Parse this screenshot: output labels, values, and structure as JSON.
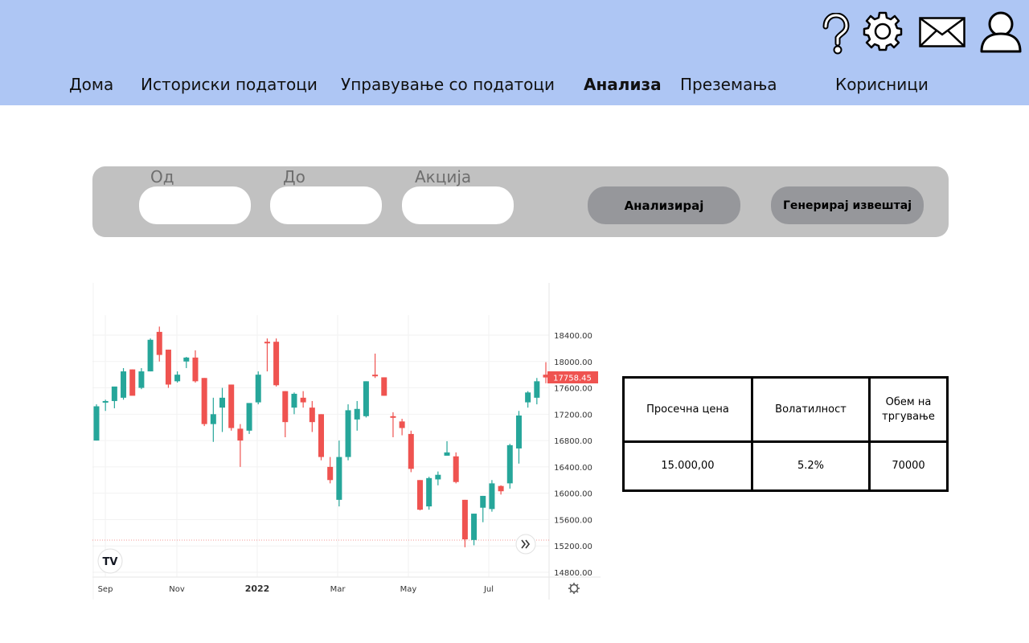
{
  "header": {
    "icons": [
      "help-icon",
      "gear-icon",
      "mail-icon",
      "user-icon"
    ],
    "background": "#aec6f4"
  },
  "nav": {
    "items": [
      {
        "label": "Дома"
      },
      {
        "label": "Историски податоци"
      },
      {
        "label": "Управување со податоци"
      },
      {
        "label": "Анализа",
        "active": true
      },
      {
        "label": "Преземања"
      },
      {
        "label": "Корисници"
      }
    ]
  },
  "filters": {
    "from_label": "Од",
    "from_value": "",
    "to_label": "До",
    "to_value": "",
    "stock_label": "Акција",
    "stock_value": "",
    "analyze_button": "Анализирај",
    "report_button": "Генерирај извештај",
    "panel_color": "#c1c1c1",
    "button_color": "#96979b"
  },
  "chart_data": {
    "type": "candlestick",
    "title": "",
    "x_ticks": [
      "Sep",
      "Nov",
      "2022",
      "Mar",
      "May",
      "Jul"
    ],
    "y_ticks": [
      18400,
      18000,
      17600,
      17200,
      16800,
      16400,
      16000,
      15600,
      15200,
      14800
    ],
    "y_tick_labels": [
      "18400.00",
      "18000.00",
      "17600.00",
      "17200.00",
      "16800.00",
      "16400.00",
      "16000.00",
      "15600.00",
      "15200.00",
      "14800.00"
    ],
    "ylim": [
      14800,
      18600
    ],
    "last_price": 17758.45,
    "last_price_label": "17758.45",
    "up_color": "#26a69a",
    "down_color": "#ef5350",
    "grid": true,
    "candles": [
      {
        "o": 16800,
        "h": 17350,
        "l": 16800,
        "c": 17320
      },
      {
        "o": 17380,
        "h": 17420,
        "l": 17250,
        "c": 17400
      },
      {
        "o": 17400,
        "h": 17560,
        "l": 17290,
        "c": 17620
      },
      {
        "o": 17450,
        "h": 17900,
        "l": 17420,
        "c": 17850
      },
      {
        "o": 17880,
        "h": 17880,
        "l": 17500,
        "c": 17480
      },
      {
        "o": 17600,
        "h": 17900,
        "l": 17580,
        "c": 17850
      },
      {
        "o": 17850,
        "h": 18350,
        "l": 17850,
        "c": 18330
      },
      {
        "o": 18450,
        "h": 18530,
        "l": 18000,
        "c": 18100
      },
      {
        "o": 18180,
        "h": 18180,
        "l": 17600,
        "c": 17650
      },
      {
        "o": 17700,
        "h": 17850,
        "l": 17680,
        "c": 17800
      },
      {
        "o": 18000,
        "h": 18070,
        "l": 17900,
        "c": 18060
      },
      {
        "o": 18060,
        "h": 18170,
        "l": 17680,
        "c": 17700
      },
      {
        "o": 17750,
        "h": 17750,
        "l": 17020,
        "c": 17050
      },
      {
        "o": 17050,
        "h": 17450,
        "l": 16780,
        "c": 17200
      },
      {
        "o": 17300,
        "h": 17600,
        "l": 16930,
        "c": 17450
      },
      {
        "o": 17650,
        "h": 17650,
        "l": 16950,
        "c": 16990
      },
      {
        "o": 16980,
        "h": 17050,
        "l": 16400,
        "c": 16800
      },
      {
        "o": 16950,
        "h": 17350,
        "l": 16900,
        "c": 17370
      },
      {
        "o": 17380,
        "h": 17850,
        "l": 17350,
        "c": 17800
      },
      {
        "o": 18300,
        "h": 18350,
        "l": 17850,
        "c": 18280
      },
      {
        "o": 18300,
        "h": 18350,
        "l": 17620,
        "c": 17640
      },
      {
        "o": 17550,
        "h": 17550,
        "l": 16850,
        "c": 17080
      },
      {
        "o": 17300,
        "h": 17530,
        "l": 17200,
        "c": 17510
      },
      {
        "o": 17450,
        "h": 17550,
        "l": 17300,
        "c": 17380
      },
      {
        "o": 17300,
        "h": 17400,
        "l": 16930,
        "c": 17080
      },
      {
        "o": 17200,
        "h": 17200,
        "l": 16500,
        "c": 16550
      },
      {
        "o": 16400,
        "h": 16550,
        "l": 16150,
        "c": 16200
      },
      {
        "o": 15900,
        "h": 16800,
        "l": 15800,
        "c": 16550
      },
      {
        "o": 16550,
        "h": 17350,
        "l": 16500,
        "c": 17260
      },
      {
        "o": 17120,
        "h": 17400,
        "l": 16950,
        "c": 17280
      },
      {
        "o": 17170,
        "h": 17700,
        "l": 17150,
        "c": 17700
      },
      {
        "o": 17800,
        "h": 18120,
        "l": 17750,
        "c": 17790
      },
      {
        "o": 17760,
        "h": 17760,
        "l": 17480,
        "c": 17480
      },
      {
        "o": 17170,
        "h": 17230,
        "l": 16850,
        "c": 17160
      },
      {
        "o": 17090,
        "h": 17130,
        "l": 16880,
        "c": 16990
      },
      {
        "o": 16900,
        "h": 16950,
        "l": 16320,
        "c": 16370
      },
      {
        "o": 16200,
        "h": 16200,
        "l": 15740,
        "c": 15750
      },
      {
        "o": 15800,
        "h": 16250,
        "l": 15750,
        "c": 16230
      },
      {
        "o": 16210,
        "h": 16330,
        "l": 16120,
        "c": 16280
      },
      {
        "o": 16570,
        "h": 16790,
        "l": 16570,
        "c": 16620
      },
      {
        "o": 16560,
        "h": 16620,
        "l": 16150,
        "c": 16170
      },
      {
        "o": 15900,
        "h": 15900,
        "l": 15180,
        "c": 15300
      },
      {
        "o": 15290,
        "h": 15690,
        "l": 15210,
        "c": 15690
      },
      {
        "o": 15780,
        "h": 15960,
        "l": 15560,
        "c": 15960
      },
      {
        "o": 15760,
        "h": 16200,
        "l": 15720,
        "c": 16150
      },
      {
        "o": 16110,
        "h": 16120,
        "l": 15980,
        "c": 16030
      },
      {
        "o": 16150,
        "h": 16750,
        "l": 16070,
        "c": 16730
      },
      {
        "o": 16680,
        "h": 17250,
        "l": 16450,
        "c": 17180
      },
      {
        "o": 17380,
        "h": 17550,
        "l": 17300,
        "c": 17530
      },
      {
        "o": 17450,
        "h": 17750,
        "l": 17350,
        "c": 17700
      },
      {
        "o": 17800,
        "h": 17990,
        "l": 17670,
        "c": 17758
      }
    ]
  },
  "stats_table": {
    "headers": [
      "Просечна цена",
      "Волатилност",
      "Обем на тргување"
    ],
    "values": [
      "15.000,00",
      "5.2%",
      "70000"
    ]
  }
}
